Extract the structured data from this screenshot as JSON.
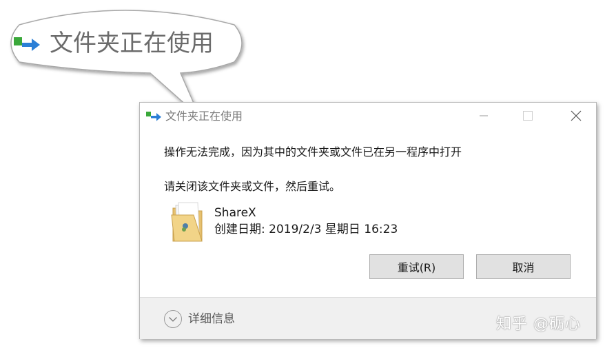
{
  "callout": {
    "title": "文件夹正在使用",
    "icon": "folder-in-use-icon"
  },
  "dialog": {
    "title": "文件夹正在使用",
    "icon": "folder-in-use-icon",
    "controls": {
      "minimize": "minimize-icon",
      "maximize": "maximize-icon",
      "close": "close-icon"
    },
    "message_line1": "操作无法完成，因为其中的文件夹或文件已在另一程序中打开",
    "message_line2": "请关闭该文件夹或文件，然后重试。",
    "file": {
      "name": "ShareX",
      "date_label": "创建日期: 2019/2/3 星期日 16:23",
      "icon": "folder-icon"
    },
    "buttons": {
      "retry": "重试(R)",
      "cancel": "取消"
    },
    "footer": {
      "details_label": "详细信息",
      "details_icon": "chevron-down-icon"
    }
  },
  "watermark": "知乎 @砺心",
  "colors": {
    "icon_green": "#3aa83a",
    "icon_blue": "#2b7fd6",
    "button_bg": "#e1e1e1",
    "footer_bg": "#f0f0f0",
    "title_gray": "#7a7a7a"
  }
}
